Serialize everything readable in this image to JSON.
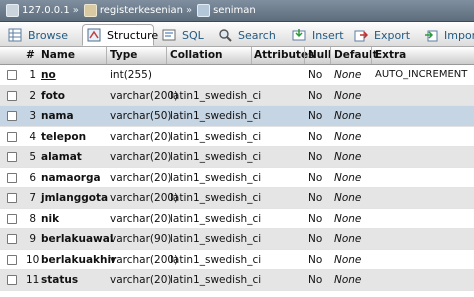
{
  "breadcrumb": {
    "server": "127.0.0.1",
    "database": "registerkesenian",
    "table": "seniman",
    "separator": "»"
  },
  "tabs": [
    {
      "label": "Browse",
      "icon": "browse-icon"
    },
    {
      "label": "Structure",
      "icon": "structure-icon",
      "active": true
    },
    {
      "label": "SQL",
      "icon": "sql-icon"
    },
    {
      "label": "Search",
      "icon": "search-icon"
    },
    {
      "label": "Insert",
      "icon": "insert-icon"
    },
    {
      "label": "Export",
      "icon": "export-icon"
    },
    {
      "label": "Impor",
      "icon": "import-icon"
    }
  ],
  "table": {
    "headers": {
      "num": "#",
      "name": "Name",
      "type": "Type",
      "collation": "Collation",
      "attributes": "Attributes",
      "null": "Null",
      "default": "Default",
      "extra": "Extra"
    },
    "rows": [
      {
        "num": "1",
        "name": "no",
        "type": "int(255)",
        "collation": "",
        "null": "No",
        "default": "None",
        "extra": "AUTO_INCREMENT"
      },
      {
        "num": "2",
        "name": "foto",
        "type": "varchar(200)",
        "collation": "latin1_swedish_ci",
        "null": "No",
        "default": "None",
        "extra": ""
      },
      {
        "num": "3",
        "name": "nama",
        "type": "varchar(50)",
        "collation": "latin1_swedish_ci",
        "null": "No",
        "default": "None",
        "extra": ""
      },
      {
        "num": "4",
        "name": "telepon",
        "type": "varchar(20)",
        "collation": "latin1_swedish_ci",
        "null": "No",
        "default": "None",
        "extra": ""
      },
      {
        "num": "5",
        "name": "alamat",
        "type": "varchar(20)",
        "collation": "latin1_swedish_ci",
        "null": "No",
        "default": "None",
        "extra": ""
      },
      {
        "num": "6",
        "name": "namaorga",
        "type": "varchar(20)",
        "collation": "latin1_swedish_ci",
        "null": "No",
        "default": "None",
        "extra": ""
      },
      {
        "num": "7",
        "name": "jmlanggota",
        "type": "varchar(200)",
        "collation": "latin1_swedish_ci",
        "null": "No",
        "default": "None",
        "extra": ""
      },
      {
        "num": "8",
        "name": "nik",
        "type": "varchar(20)",
        "collation": "latin1_swedish_ci",
        "null": "No",
        "default": "None",
        "extra": ""
      },
      {
        "num": "9",
        "name": "berlakuawal",
        "type": "varchar(90)",
        "collation": "latin1_swedish_ci",
        "null": "No",
        "default": "None",
        "extra": ""
      },
      {
        "num": "10",
        "name": "berlakuakhir",
        "type": "varchar(200)",
        "collation": "latin1_swedish_ci",
        "null": "No",
        "default": "None",
        "extra": ""
      },
      {
        "num": "11",
        "name": "status",
        "type": "varchar(20)",
        "collation": "latin1_swedish_ci",
        "null": "No",
        "default": "None",
        "extra": ""
      }
    ]
  },
  "colors": {
    "breadcrumb_bg": "#6e7e8d",
    "link": "#235a81",
    "row_alt": "#e5e5e5",
    "row_highlight": "#c6d5e4"
  }
}
